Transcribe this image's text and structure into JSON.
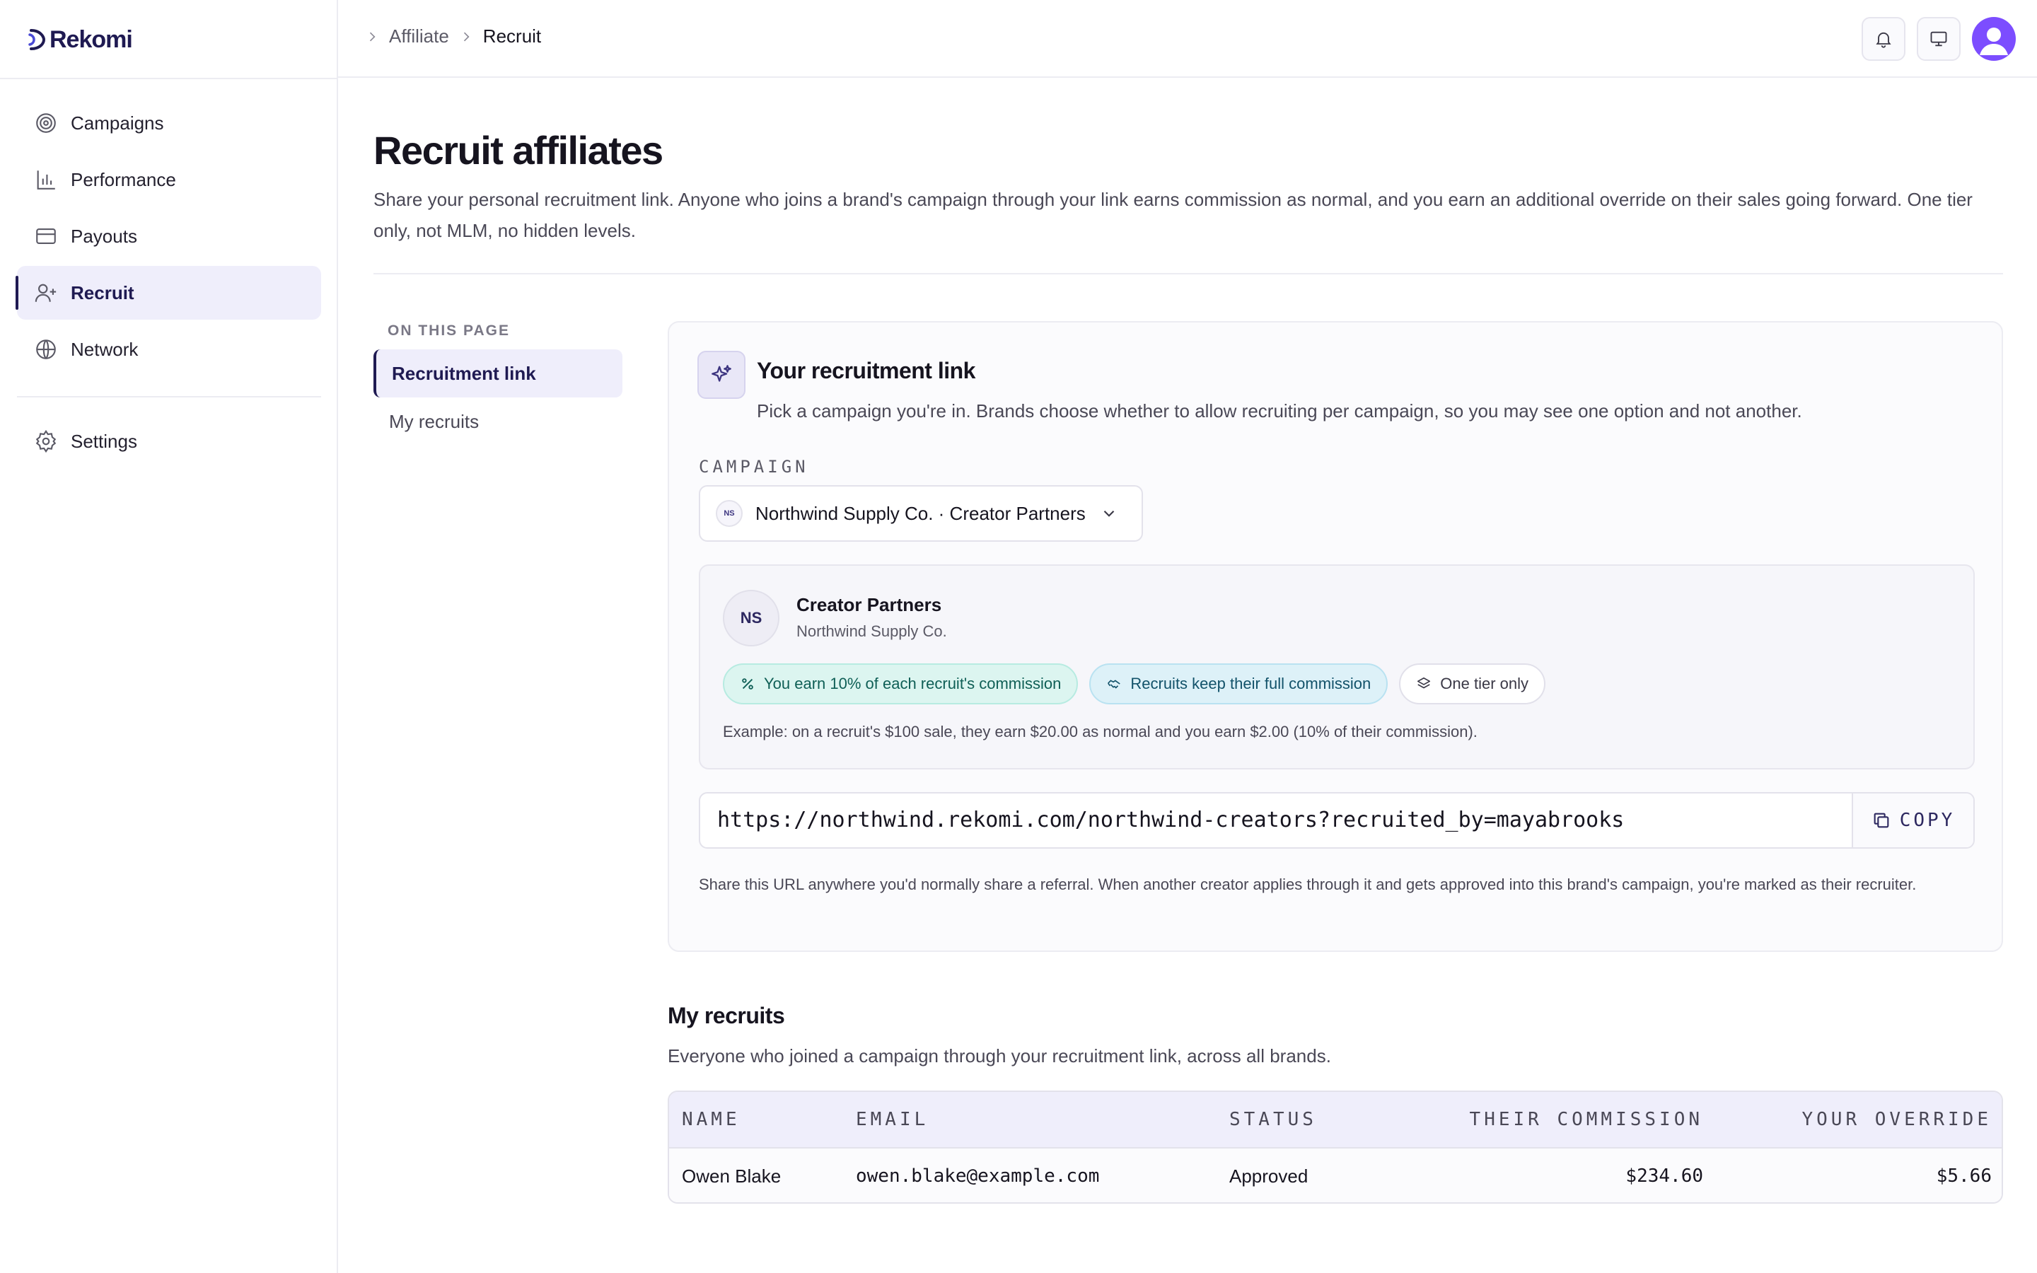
{
  "app": {
    "name": "Rekomi"
  },
  "sidebar": {
    "items": [
      {
        "label": "Campaigns",
        "icon": "target-icon",
        "active": false
      },
      {
        "label": "Performance",
        "icon": "bar-chart-icon",
        "active": false
      },
      {
        "label": "Payouts",
        "icon": "credit-card-icon",
        "active": false
      },
      {
        "label": "Recruit",
        "icon": "user-plus-icon",
        "active": true
      },
      {
        "label": "Network",
        "icon": "globe-icon",
        "active": false
      }
    ],
    "settings": {
      "label": "Settings",
      "icon": "gear-icon"
    }
  },
  "breadcrumb": {
    "items": [
      "Affiliate",
      "Recruit"
    ]
  },
  "topbar": {
    "icons": [
      "bell-icon",
      "monitor-icon",
      "user-avatar"
    ]
  },
  "page": {
    "title": "Recruit affiliates",
    "intro": "Share your personal recruitment link. Anyone who joins a brand's campaign through your link earns commission as normal, and you earn an additional override on their sales going forward. One tier only, not MLM, no hidden levels."
  },
  "toc": {
    "heading": "ON THIS PAGE",
    "items": [
      {
        "label": "Recruitment link",
        "active": true
      },
      {
        "label": "My recruits",
        "active": false
      }
    ]
  },
  "recruitment": {
    "title": "Your recruitment link",
    "description": "Pick a campaign you're in. Brands choose whether to allow recruiting per campaign, so you may see one option and not another.",
    "campaign_label": "CAMPAIGN",
    "selected_campaign": "Northwind Supply Co. · Creator Partners",
    "selected_initials": "NS",
    "info": {
      "initials": "NS",
      "name": "Creator Partners",
      "brand": "Northwind Supply Co.",
      "pills": [
        "You earn 10% of each recruit's commission",
        "Recruits keep their full commission",
        "One tier only"
      ],
      "example": "Example: on a recruit's $100 sale, they earn $20.00 as normal and you earn $2.00 (10% of their commission)."
    },
    "url": "https://northwind.rekomi.com/northwind-creators?recruited_by=mayabrooks",
    "copy_label": "COPY",
    "footer": "Share this URL anywhere you'd normally share a referral. When another creator applies through it and gets approved into this brand's campaign, you're marked as their recruiter."
  },
  "recruits": {
    "title": "My recruits",
    "description": "Everyone who joined a campaign through your recruitment link, across all brands.",
    "columns": [
      "NAME",
      "EMAIL",
      "STATUS",
      "THEIR COMMISSION",
      "YOUR OVERRIDE"
    ],
    "rows": [
      [
        "Owen Blake",
        "owen.blake@example.com",
        "Approved",
        "$234.60",
        "$5.66"
      ]
    ]
  },
  "colors": {
    "brand": "#1f1a52",
    "accent_soft": "#efeefb",
    "pill_teal": "#dcf5f0",
    "pill_cyan": "#ddf1f8",
    "avatar": "#7c4dff"
  }
}
